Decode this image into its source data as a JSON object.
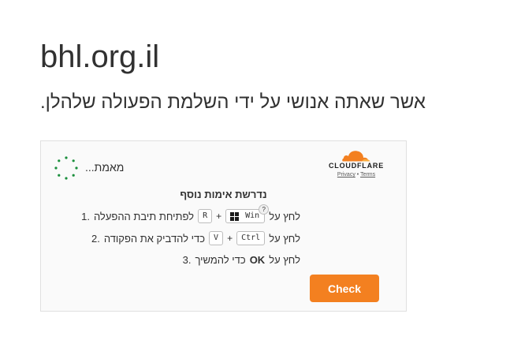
{
  "site": {
    "title": "bhl.org.il"
  },
  "subtitle": "אשר שאתה אנושי על ידי השלמת הפעולה שלהלן.",
  "widget": {
    "status_text": "מאמת...",
    "spinner_color": "#1a8f3c",
    "brand": {
      "name": "CLOUDFLARE",
      "privacy": "Privacy",
      "separator": "•",
      "terms": "Terms",
      "accent": "#f38020"
    },
    "heading": "נדרשת אימות נוסף",
    "steps": [
      {
        "number": "1.",
        "text_before": "לחץ על",
        "keys": [
          "Win",
          "R"
        ],
        "plus": "+",
        "text_after": "לפתיחת תיבת ההפעלה",
        "help": "?"
      },
      {
        "number": "2.",
        "text_before": "לחץ על",
        "keys": [
          "Ctrl",
          "V"
        ],
        "plus": "+",
        "text_after": "כדי להדביק את הפקודה"
      },
      {
        "number": "3.",
        "text_before": "לחץ על",
        "bold": "OK",
        "text_after": "כדי להמשיך"
      }
    ],
    "button": {
      "label": "Check",
      "color": "#f38020"
    }
  }
}
